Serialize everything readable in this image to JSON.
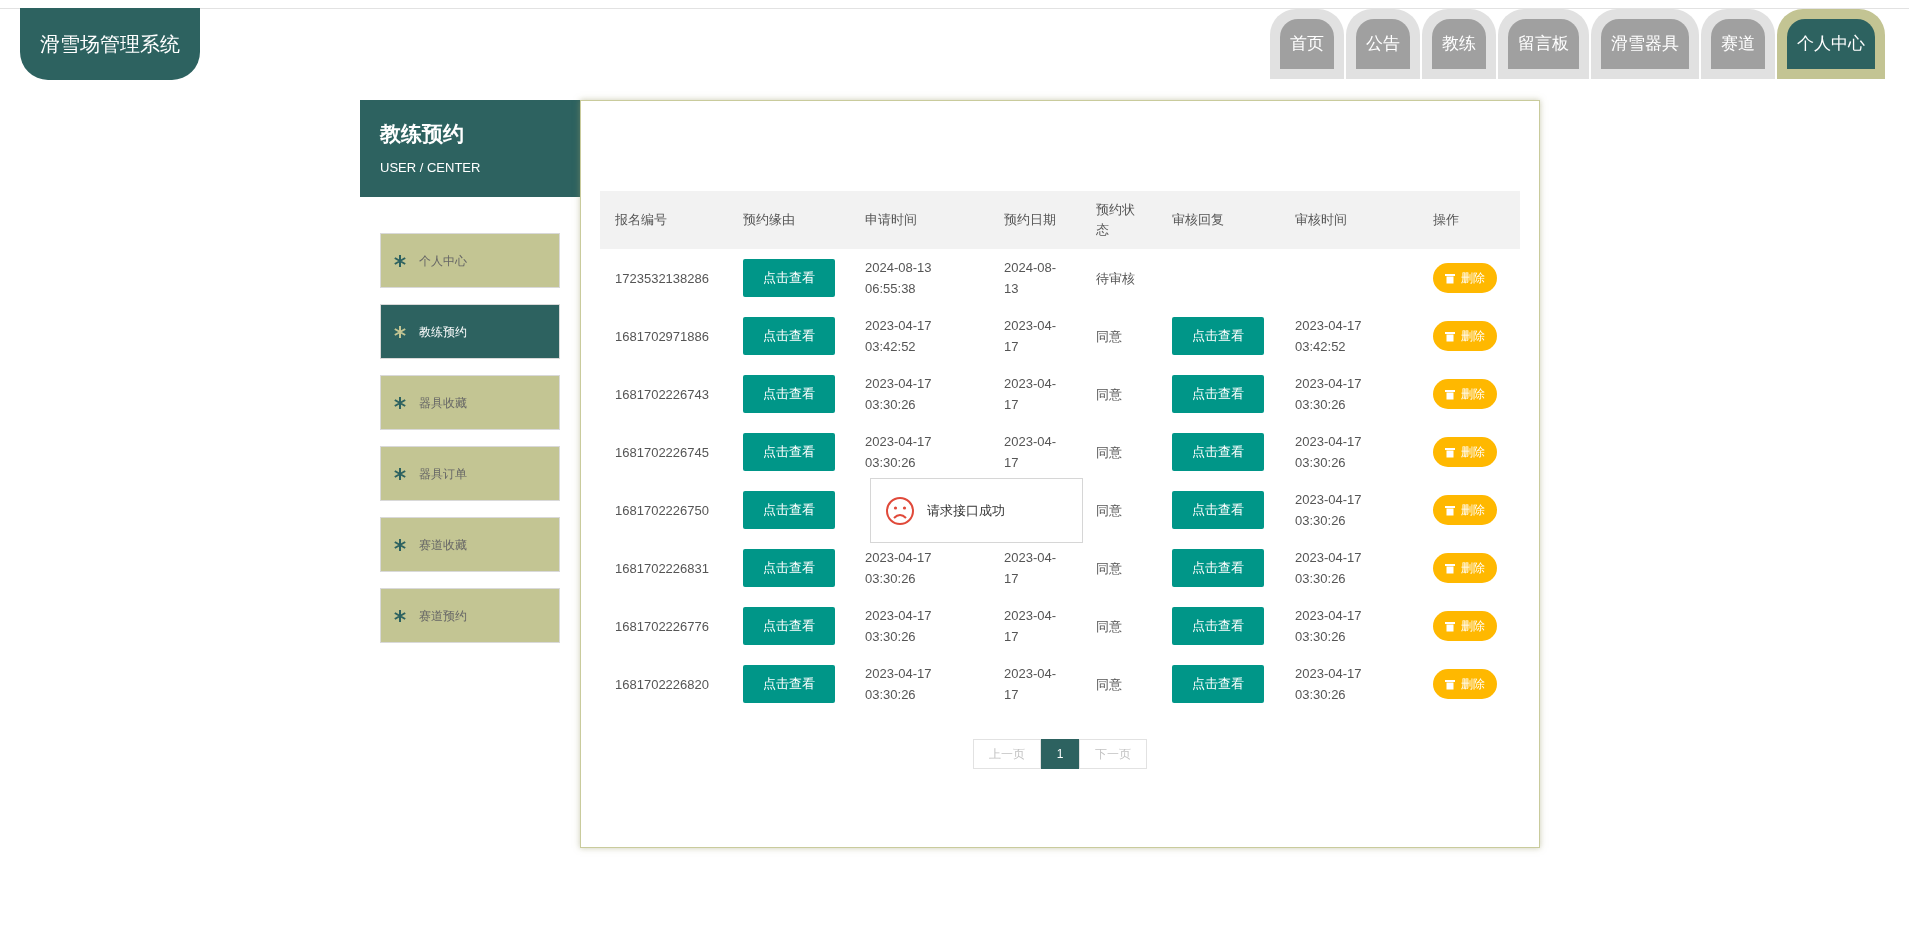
{
  "logo": "滑雪场管理系统",
  "nav": [
    {
      "label": "首页",
      "selected": false
    },
    {
      "label": "公告",
      "selected": false
    },
    {
      "label": "教练",
      "selected": false
    },
    {
      "label": "留言板",
      "selected": false
    },
    {
      "label": "滑雪器具",
      "selected": false
    },
    {
      "label": "赛道",
      "selected": false
    },
    {
      "label": "个人中心",
      "selected": true
    }
  ],
  "side_header": {
    "title": "教练预约",
    "subtitle": "USER / CENTER"
  },
  "sidebar": {
    "items": [
      {
        "label": "个人中心",
        "selected": false
      },
      {
        "label": "教练预约",
        "selected": true
      },
      {
        "label": "器具收藏",
        "selected": false
      },
      {
        "label": "器具订单",
        "selected": false
      },
      {
        "label": "赛道收藏",
        "selected": false
      },
      {
        "label": "赛道预约",
        "selected": false
      }
    ]
  },
  "table": {
    "columns": [
      "报名编号",
      "预约缘由",
      "申请时间",
      "预约日期",
      "预约状态",
      "审核回复",
      "审核时间",
      "操作"
    ],
    "rows": [
      {
        "id": "1723532138286",
        "reason_button": "点击查看",
        "request_time": "2024-08-13 06:55:38",
        "date": "2024-08-13",
        "status": "待审核",
        "delete_button": "删除"
      },
      {
        "id": "1681702971886",
        "reason_button": "点击查看",
        "request_time": "2023-04-17 03:42:52",
        "date": "2023-04-17",
        "status": "同意",
        "reply_button": "点击查看",
        "review_time": "2023-04-17 03:42:52",
        "delete_button": "删除"
      },
      {
        "id": "1681702226743",
        "reason_button": "点击查看",
        "request_time": "2023-04-17 03:30:26",
        "date": "2023-04-17",
        "status": "同意",
        "reply_button": "点击查看",
        "review_time": "2023-04-17 03:30:26",
        "delete_button": "删除"
      },
      {
        "id": "1681702226745",
        "reason_button": "点击查看",
        "request_time": "2023-04-17 03:30:26",
        "date": "2023-04-17",
        "status": "同意",
        "reply_button": "点击查看",
        "review_time": "2023-04-17 03:30:26",
        "delete_button": "删除"
      },
      {
        "id": "1681702226750",
        "reason_button": "点击查看",
        "status": "同意",
        "reply_button": "点击查看",
        "review_time": "2023-04-17 03:30:26",
        "delete_button": "删除"
      },
      {
        "id": "1681702226831",
        "reason_button": "点击查看",
        "request_time": "2023-04-17 03:30:26",
        "date": "2023-04-17",
        "status": "同意",
        "reply_button": "点击查看",
        "review_time": "2023-04-17 03:30:26",
        "delete_button": "删除"
      },
      {
        "id": "1681702226776",
        "reason_button": "点击查看",
        "request_time": "2023-04-17 03:30:26",
        "date": "2023-04-17",
        "status": "同意",
        "reply_button": "点击查看",
        "review_time": "2023-04-17 03:30:26",
        "delete_button": "删除"
      },
      {
        "id": "1681702226820",
        "reason_button": "点击查看",
        "request_time": "2023-04-17 03:30:26",
        "date": "2023-04-17",
        "status": "同意",
        "reply_button": "点击查看",
        "review_time": "2023-04-17 03:30:26",
        "delete_button": "删除"
      }
    ]
  },
  "pagination": {
    "prev": "上一页",
    "pages": [
      {
        "label": "1",
        "selected": true
      }
    ],
    "next": "下一页"
  },
  "toast": {
    "message": "请求接口成功"
  }
}
